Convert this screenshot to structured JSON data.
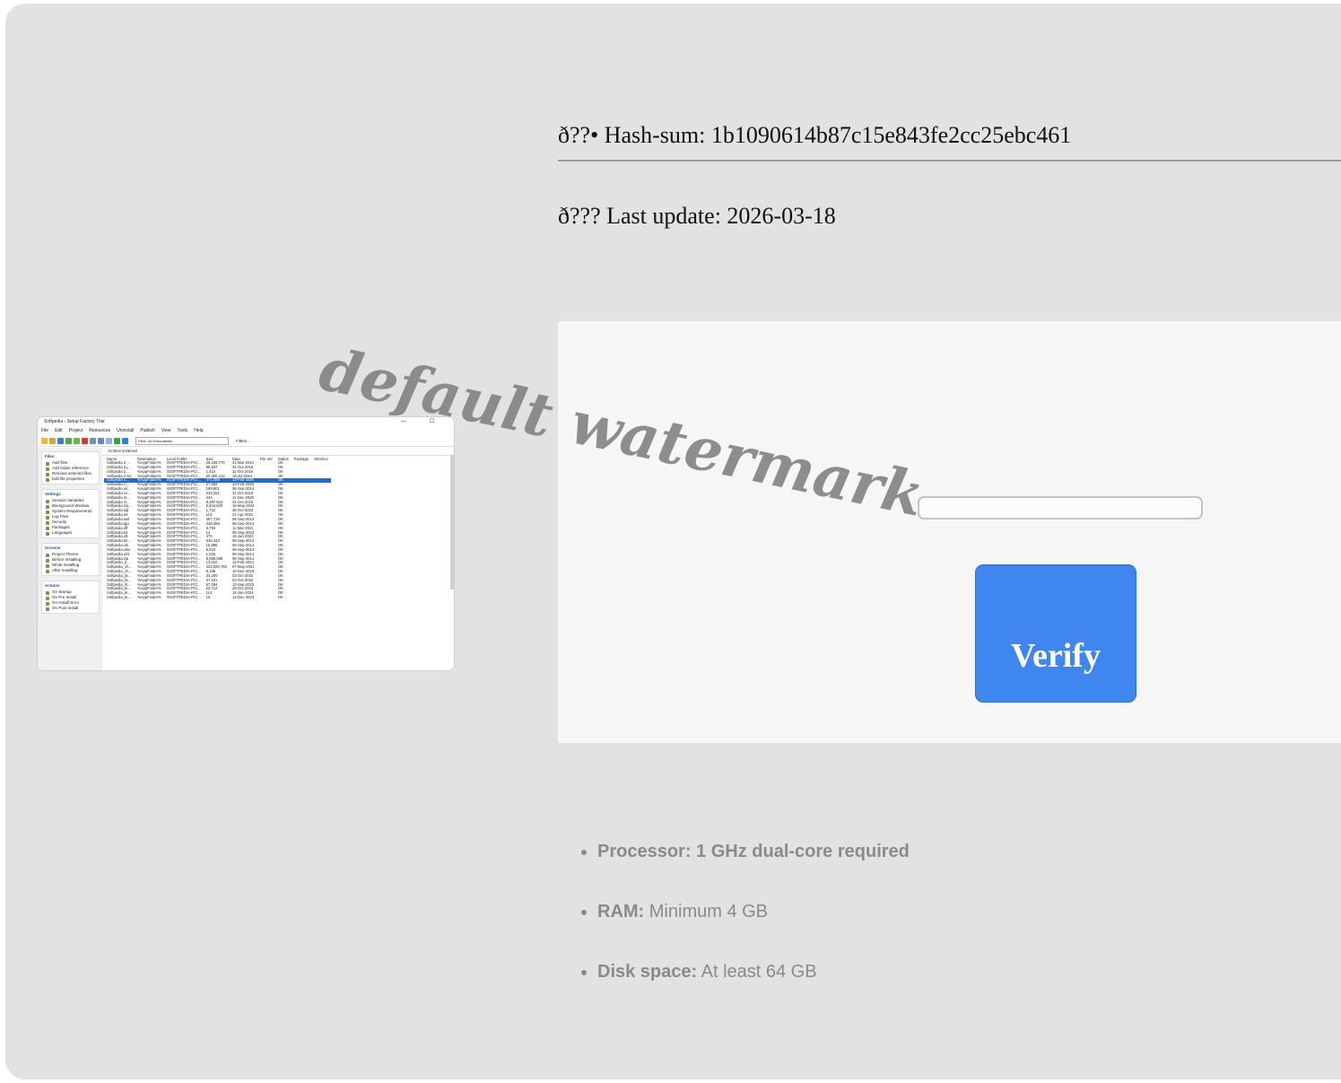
{
  "info": {
    "hash_text": "ð??• Hash-sum: 1b1090614b87c15e843fe2cc25ebc461",
    "update_text": "ð??? Last update: 2026-03-18"
  },
  "verify": {
    "input_value": "",
    "button_label": "Verify"
  },
  "watermark": "default watermark",
  "screenshot": {
    "window_title": "Softpedia - Setup Factory Trial",
    "window_controls": "— ☐",
    "menu": [
      "File",
      "Edit",
      "Project",
      "Resources",
      "Uninstall",
      "Publish",
      "View",
      "Tools",
      "Help"
    ],
    "filter_label": "Filter: All Executables",
    "filters_button": "Filters...",
    "tabs": "Archive   External",
    "sidebar": [
      {
        "header": "Files",
        "items": [
          "Add files",
          "Add folder reference",
          "Remove selected files",
          "Edit file properties"
        ]
      },
      {
        "header": "Settings",
        "items": [
          "Session Variables",
          "Background Window",
          "System Requirements",
          "Log Files",
          "Security",
          "Packages",
          "Languages"
        ]
      },
      {
        "header": "Screens",
        "items": [
          "Project Theme",
          "Before Installing",
          "While Installing",
          "After Installing"
        ]
      },
      {
        "header": "Actions",
        "items": [
          "On Startup",
          "On Pre Install",
          "On Install Error",
          "On Post Install"
        ]
      }
    ],
    "columns": [
      "Name",
      "Destination",
      "Local Folder",
      "Size",
      "Date",
      "File Ver",
      "Status",
      "Package",
      "Shortcut"
    ],
    "rows": [
      [
        "Softpedia 2 ...",
        "%AppFolder%",
        "\\\\SOFTPEDIA-PC\\...",
        "26,339,770",
        "21-Mar-2024",
        "",
        "OK"
      ],
      [
        "Softpedia 2.j...",
        "%AppFolder%",
        "\\\\SOFTPEDIA-PC\\...",
        "95,537",
        "31-Oct-2016",
        "",
        "OK"
      ],
      [
        "Softpedia 2...",
        "%AppFolder%",
        "\\\\SOFTPEDIA-PC\\...",
        "1,415",
        "31-Oct-2016",
        "",
        "OK"
      ],
      [
        "Softpedia 2.txt",
        "%AppFolder%",
        "\\\\SOFTPEDIA-PC\\...",
        "20,400,212",
        "19-Jul-2024",
        "",
        "OK"
      ],
      [
        "Softpedia C...",
        "%AppFolder%",
        "\\\\SOFTPEDIA-PC\\...",
        "471,088",
        "13-Feb-2025",
        "",
        "OK"
      ],
      [
        "Softpedia C...",
        "%AppFolder%",
        "\\\\SOFTPEDIA-PC\\...",
        "27,692",
        "13-Feb-2025",
        "",
        "OK"
      ],
      [
        "Softpedia ini...",
        "%AppFolder%",
        "\\\\SOFTPEDIA-PC\\...",
        "199,601",
        "06-Sep-2014",
        "",
        "OK"
      ],
      [
        "Softpedia Le...",
        "%AppFolder%",
        "\\\\SOFTPEDIA-PC\\...",
        "233,291",
        "31-Oct-2016",
        "",
        "OK"
      ],
      [
        "Softpedia m...",
        "%AppFolder%",
        "\\\\SOFTPEDIA-PC\\...",
        "444",
        "11-Dec-2020",
        "",
        "OK"
      ],
      [
        "Softpedia O...",
        "%AppFolder%",
        "\\\\SOFTPEDIA-PC\\...",
        "8,387,824",
        "31-Oct-2016",
        "",
        "OK"
      ],
      [
        "Softpedia Sp...",
        "%AppFolder%",
        "\\\\SOFTPEDIA-PC\\...",
        "5,944,920",
        "16-May-2024",
        "",
        "OK"
      ],
      [
        "Softpedia.sql",
        "%AppFolder%",
        "\\\\SOFTPEDIA-PC\\...",
        "1,722",
        "30-Oct-2023",
        "",
        "OK"
      ],
      [
        "Softpedia.srt",
        "%AppFolder%",
        "\\\\SOFTPEDIA-PC\\...",
        "113",
        "21-Apr-2021",
        "",
        "OK"
      ],
      [
        "Softpedia.swf",
        "%AppFolder%",
        "\\\\SOFTPEDIA-PC\\...",
        "497,728",
        "06-Sep-2014",
        "",
        "OK"
      ],
      [
        "Softpedia.tga",
        "%AppFolder%",
        "\\\\SOFTPEDIA-PC\\...",
        "248,366",
        "06-Sep-2014",
        "",
        "OK"
      ],
      [
        "Softpedia.tiff",
        "%AppFolder%",
        "\\\\SOFTPEDIA-PC\\...",
        "6,794",
        "11-Mar-2021",
        "",
        "OK"
      ],
      [
        "Softpedia.txt",
        "%AppFolder%",
        "\\\\SOFTPEDIA-PC\\...",
        "14",
        "09-Sep-2023",
        "",
        "OK"
      ],
      [
        "Softpedia.vtt",
        "%AppFolder%",
        "\\\\SOFTPEDIA-PC\\...",
        "470",
        "16-Jan-2023",
        "",
        "OK"
      ],
      [
        "Softpedia.W...",
        "%AppFolder%",
        "\\\\SOFTPEDIA-PC\\...",
        "645,343",
        "06-Sep-2014",
        "",
        "OK"
      ],
      [
        "Softpedia.xls",
        "%AppFolder%",
        "\\\\SOFTPEDIA-PC\\...",
        "16,896",
        "06-Sep-2014",
        "",
        "OK"
      ],
      [
        "Softpedia.xlsx",
        "%AppFolder%",
        "\\\\SOFTPEDIA-PC\\...",
        "8,524",
        "06-Sep-2014",
        "",
        "OK"
      ],
      [
        "Softpedia.xml",
        "%AppFolder%",
        "\\\\SOFTPEDIA-PC\\...",
        "1,025",
        "06-Sep-2014",
        "",
        "OK"
      ],
      [
        "Softpedia.zip",
        "%AppFolder%",
        "\\\\SOFTPEDIA-PC\\...",
        "8,085,598",
        "06-Sep-2014",
        "",
        "OK"
      ],
      [
        "Softpedia_b...",
        "%AppFolder%",
        "\\\\SOFTPEDIA-PC\\...",
        "13,010",
        "12-Feb-2024",
        "",
        "OK"
      ],
      [
        "Softpedia_ch...",
        "%AppFolder%",
        "\\\\SOFTPEDIA-PC\\...",
        "423,020,760",
        "07-May-2021",
        "",
        "OK"
      ],
      [
        "Softpedia_ch...",
        "%AppFolder%",
        "\\\\SOFTPEDIA-PC\\...",
        "8,186",
        "10-Nov-2023",
        "",
        "OK"
      ],
      [
        "Softpedia_fa...",
        "%AppFolder%",
        "\\\\SOFTPEDIA-PC\\...",
        "34,200",
        "03-Oct-2022",
        "",
        "OK"
      ],
      [
        "Softpedia_fa...",
        "%AppFolder%",
        "\\\\SOFTPEDIA-PC\\...",
        "37,101",
        "03-Oct-2022",
        "",
        "OK"
      ],
      [
        "Softpedia_fo...",
        "%AppFolder%",
        "\\\\SOFTPEDIA-PC\\...",
        "57,294",
        "13-Sep-2023",
        "",
        "OK"
      ],
      [
        "Softpedia_te...",
        "%AppFolder%",
        "\\\\SOFTPEDIA-PC\\...",
        "23,712",
        "20-Oct-2023",
        "",
        "OK"
      ],
      [
        "Softpedia_te...",
        "%AppFolder%",
        "\\\\SOFTPEDIA-PC\\...",
        "114",
        "12-Jan-2024",
        "",
        "OK"
      ],
      [
        "Softpedia_te...",
        "%AppFolder%",
        "\\\\SOFTPEDIA-PC\\...",
        "18",
        "13-Dec-2023",
        "",
        "OK"
      ]
    ],
    "selected_row": 4
  },
  "requirements": [
    {
      "label": "Processor: 1 GHz dual-core required",
      "value": ""
    },
    {
      "label": "RAM:",
      "value": " Minimum 4 GB"
    },
    {
      "label": "Disk space:",
      "value": " At least 64 GB"
    }
  ]
}
